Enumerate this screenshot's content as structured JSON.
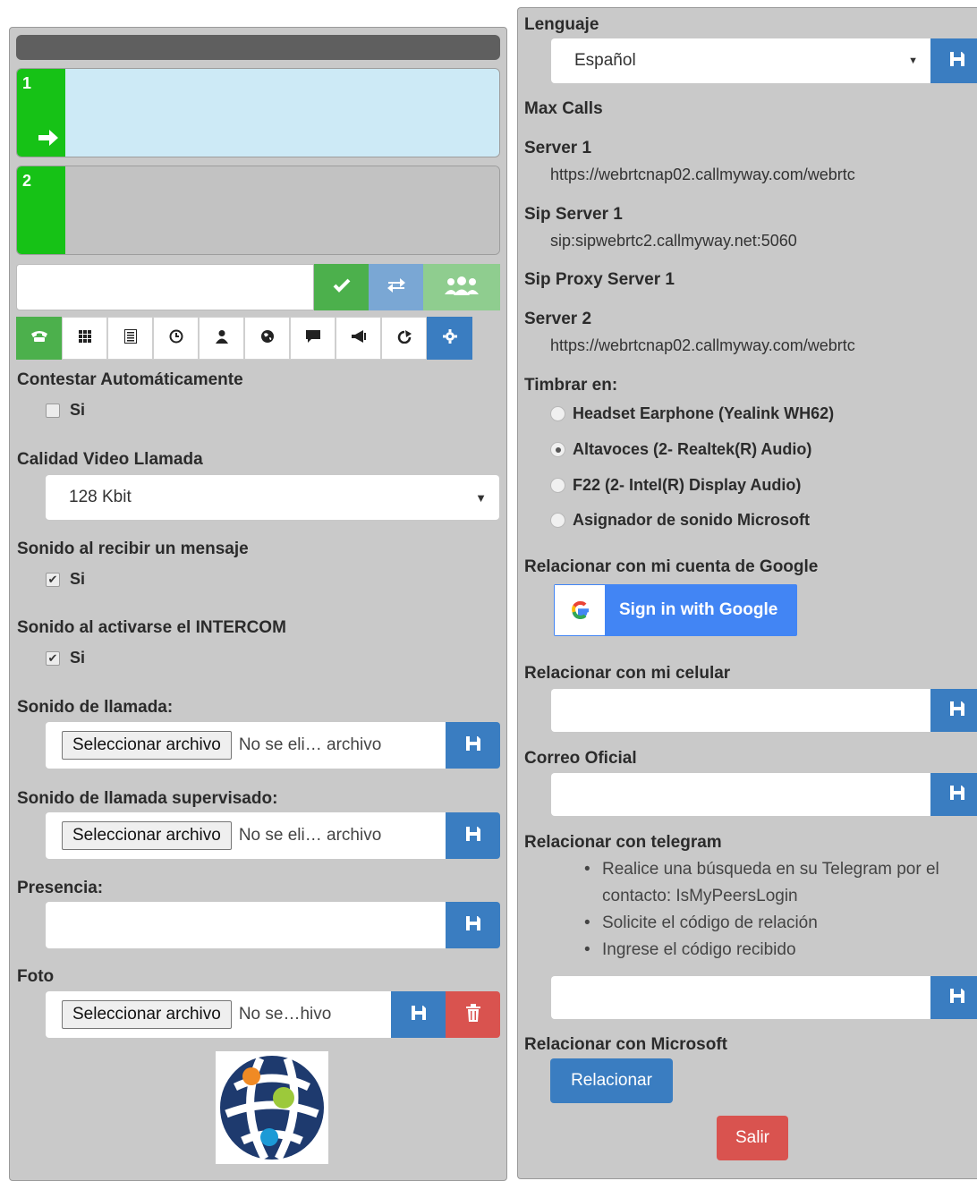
{
  "phone": {
    "lines": [
      {
        "number": "1",
        "color": "#cdeaf6"
      },
      {
        "number": "2",
        "color": "#c2c2c2"
      }
    ]
  },
  "colors": {
    "green": "#16c216",
    "button_green": "#5cb85c",
    "button_blue": "#3a7dc1",
    "button_red": "#d9534f"
  },
  "settings": {
    "auto_answer": {
      "label": "Contestar Automáticamente",
      "option": "Si",
      "checked": false
    },
    "video_quality": {
      "label": "Calidad Video Llamada",
      "value": "128 Kbit"
    },
    "message_sound": {
      "label": "Sonido al recibir un mensaje",
      "option": "Si",
      "checked": true
    },
    "intercom_sound": {
      "label": "Sonido al activarse el INTERCOM",
      "option": "Si",
      "checked": true
    },
    "call_sound": {
      "label": "Sonido de llamada:",
      "file_button": "Seleccionar archivo",
      "file_status": "No se eli… archivo"
    },
    "supervised_sound": {
      "label": "Sonido de llamada supervisado:",
      "file_button": "Seleccionar archivo",
      "file_status": "No se eli… archivo"
    },
    "presence": {
      "label": "Presencia:",
      "value": ""
    },
    "photo": {
      "label": "Foto",
      "file_button": "Seleccionar archivo",
      "file_status": "No se…hivo"
    }
  },
  "right": {
    "language": {
      "label": "Lenguaje",
      "value": "Español"
    },
    "max_calls": {
      "label": "Max Calls"
    },
    "server1": {
      "label": "Server 1",
      "value": "https://webrtcnap02.callmyway.com/webrtc"
    },
    "sip_server1": {
      "label": "Sip Server 1",
      "value": "sip:sipwebrtc2.callmyway.net:5060"
    },
    "sip_proxy1": {
      "label": "Sip Proxy Server 1"
    },
    "server2": {
      "label": "Server 2",
      "value": "https://webrtcnap02.callmyway.com/webrtc"
    },
    "ring_on": {
      "label": "Timbrar en:",
      "options": [
        {
          "label": "Headset Earphone (Yealink WH62)",
          "selected": false
        },
        {
          "label": "Altavoces (2- Realtek(R) Audio)",
          "selected": true
        },
        {
          "label": "F22 (2- Intel(R) Display Audio)",
          "selected": false
        },
        {
          "label": "Asignador de sonido Microsoft",
          "selected": false
        }
      ]
    },
    "google": {
      "label": "Relacionar con mi cuenta de Google",
      "button": "Sign in with Google"
    },
    "cellphone": {
      "label": "Relacionar con mi celular",
      "value": ""
    },
    "email": {
      "label": "Correo Oficial",
      "value": ""
    },
    "telegram": {
      "label": "Relacionar con telegram",
      "steps": [
        "Realice una búsqueda en su Telegram por el contacto: IsMyPeersLogin",
        "Solicite el código de relación",
        "Ingrese el código recibido"
      ],
      "value": ""
    },
    "microsoft": {
      "label": "Relacionar con Microsoft",
      "button": "Relacionar"
    },
    "logout": "Salir"
  }
}
